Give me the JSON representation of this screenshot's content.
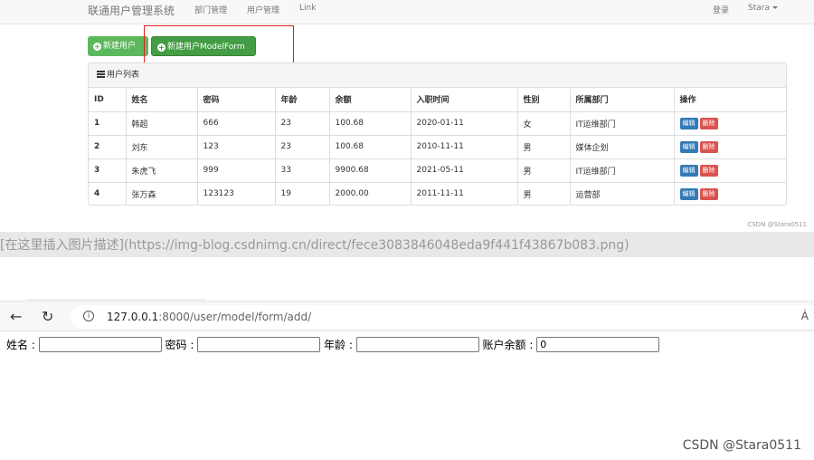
{
  "app": {
    "brand": "联通用户管理系统",
    "nav": [
      "部门管理",
      "用户管理",
      "Link"
    ],
    "login": "登录",
    "user": "Stara"
  },
  "buttons": {
    "add_user": "新建用户",
    "add_user_modelform": "新建用户ModelForm"
  },
  "panel": {
    "title": "用户列表",
    "columns": [
      "ID",
      "姓名",
      "密码",
      "年龄",
      "余额",
      "入职时间",
      "性别",
      "所属部门",
      "操作"
    ],
    "edit_label": "编辑",
    "delete_label": "删除",
    "rows": [
      [
        "1",
        "韩超",
        "666",
        "23",
        "100.68",
        "2020-01-11",
        "女",
        "IT运维部门"
      ],
      [
        "2",
        "刘东",
        "123",
        "23",
        "100.68",
        "2010-11-11",
        "男",
        "媒体企划"
      ],
      [
        "3",
        "朱虎飞",
        "999",
        "33",
        "9900.68",
        "2021-05-11",
        "男",
        "IT运维部门"
      ],
      [
        "4",
        "张万森",
        "123123",
        "19",
        "2000.00",
        "2011-11-11",
        "男",
        "运营部"
      ]
    ]
  },
  "watermark_small": "CSDN @Stara0511",
  "alt_text": "[在这里插入图片描述](https://img-blog.csdnimg.cn/direct/fece3083846048eda9f441f43867b083.png)",
  "browser": {
    "url_host": "127.0.0.1",
    "url_path": ":8000/user/model/form/add/",
    "reader_icon": "Á",
    "form": {
      "name_label": "姓名 :",
      "name_value": "",
      "password_label": "密码 :",
      "password_value": "",
      "age_label": "年龄 :",
      "age_value": "",
      "balance_label": "账户余额 :",
      "balance_value": "0"
    }
  },
  "watermark_big": "CSDN @Stara0511",
  "colors": {
    "success": "#5cb85c",
    "success_dark": "#449d44",
    "highlight_box": "#e02020",
    "primary": "#337ab7",
    "danger": "#d9534f"
  }
}
